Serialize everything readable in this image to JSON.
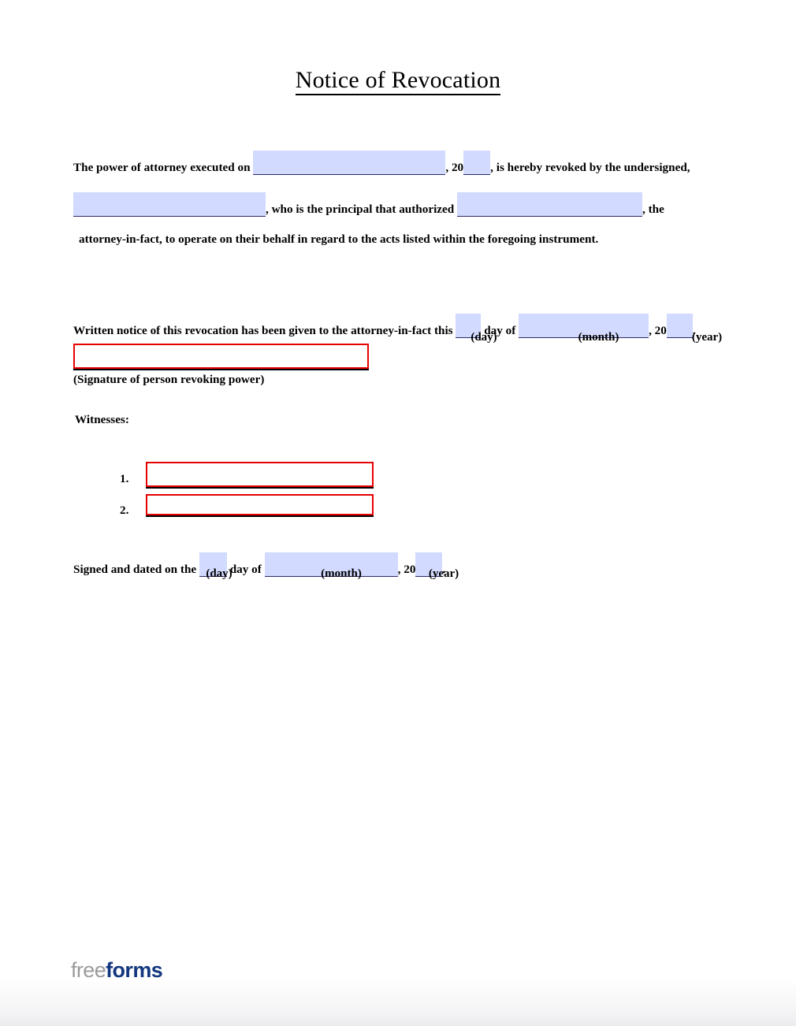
{
  "document": {
    "title": "Notice of Revocation"
  },
  "paragraph1": {
    "line1_pre": "The power of attorney executed on",
    "line1_mid": ", 20",
    "line1_post": ", is hereby revoked by the undersigned,",
    "line2_mid": ", who is the principal that authorized",
    "line2_post": ", the",
    "line3": "attorney-in-fact, to operate on their behalf in regard to the acts listed within the foregoing instrument."
  },
  "notice": {
    "text_pre": "Written notice of this revocation has been given to the attorney-in-fact this",
    "text_mid": "day of",
    "text_year_prefix": ", 20",
    "text_end": ".",
    "caption_day": "(day)",
    "caption_month": "(month)",
    "caption_year": "(year)"
  },
  "signature": {
    "caption": "(Signature of person revoking power)",
    "value": ""
  },
  "witnesses": {
    "heading": "Witnesses:",
    "items": [
      {
        "number": "1.",
        "value": ""
      },
      {
        "number": "2.",
        "value": ""
      }
    ]
  },
  "signed_dated": {
    "text_pre": "Signed and dated on the",
    "text_mid": "day of",
    "text_year_prefix": ", 20",
    "text_end": ".",
    "caption_day": "(day)",
    "caption_month": "(month)",
    "caption_year": "(year)"
  },
  "footer": {
    "logo_part1": "free",
    "logo_part2": "forms"
  },
  "fields": {
    "poa_date": "",
    "poa_year": "",
    "principal_name": "",
    "attorney_name": "",
    "notice_day": "",
    "notice_month": "",
    "notice_year": "",
    "signed_day": "",
    "signed_month": "",
    "signed_year": ""
  },
  "colors": {
    "field_fill": "#d2daff",
    "field_underline": "#2b2b6b",
    "signature_border": "#e60000",
    "logo_gray": "#9a9a9a",
    "logo_navy": "#14387f"
  }
}
